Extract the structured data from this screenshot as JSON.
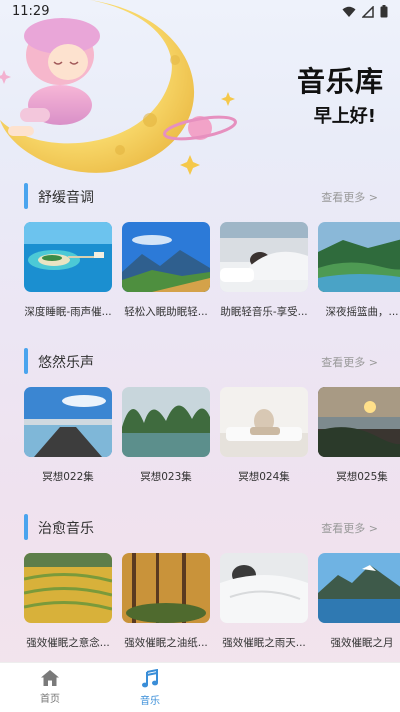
{
  "status_bar": {
    "time": "11:29"
  },
  "header": {
    "title": "音乐库",
    "greeting": "早上好!"
  },
  "sections": [
    {
      "title": "舒缓音调",
      "more": "查看更多 >",
      "items": [
        {
          "caption": "深度睡眠-雨声催..."
        },
        {
          "caption": "轻松入眠助眠轻..."
        },
        {
          "caption": "助眠轻音乐-享受..."
        },
        {
          "caption": "深夜摇篮曲，..."
        }
      ]
    },
    {
      "title": "悠然乐声",
      "more": "查看更多 >",
      "items": [
        {
          "caption": "冥想022集"
        },
        {
          "caption": "冥想023集"
        },
        {
          "caption": "冥想024集"
        },
        {
          "caption": "冥想025集"
        }
      ]
    },
    {
      "title": "治愈音乐",
      "more": "查看更多 >",
      "items": [
        {
          "caption": "强效催眠之意念..."
        },
        {
          "caption": "强效催眠之油纸..."
        },
        {
          "caption": "强效催眠之雨天..."
        },
        {
          "caption": "强效催眠之月"
        }
      ]
    }
  ],
  "bottom_nav": [
    {
      "label": "首页",
      "icon": "home-icon",
      "active": false
    },
    {
      "label": "音乐",
      "icon": "music-note-icon",
      "active": true
    }
  ],
  "colors": {
    "accent": "#4aa4ee",
    "active_nav": "#3a8ed8"
  }
}
